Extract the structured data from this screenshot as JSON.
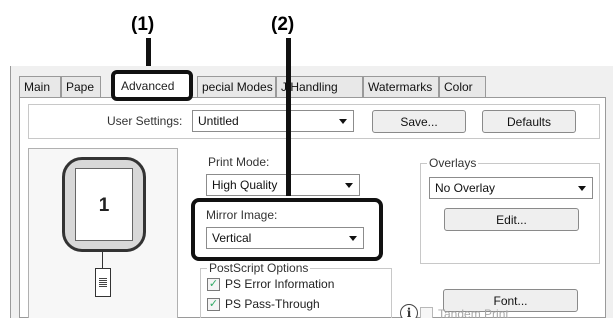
{
  "callouts": {
    "one": "(1)",
    "two": "(2)"
  },
  "tabs": {
    "main": "Main",
    "paper": "Pape",
    "advanced": "Advanced",
    "special_modes": "pecial Modes",
    "job_handling": "J  Handling",
    "watermarks": "Watermarks",
    "color": "Color"
  },
  "user_settings": {
    "label": "User Settings:",
    "value": "Untitled",
    "save_label": "Save...",
    "defaults_label": "Defaults"
  },
  "preview": {
    "page_number": "1"
  },
  "print_mode": {
    "label": "Print Mode:",
    "value": "High Quality"
  },
  "mirror_image": {
    "label": "Mirror Image:",
    "value": "Vertical"
  },
  "postscript": {
    "title": "PostScript Options",
    "error_info": {
      "label": "PS Error Information",
      "checked": true
    },
    "pass_through": {
      "label": "PS Pass-Through",
      "checked": true
    }
  },
  "overlays": {
    "title": "Overlays",
    "value": "No Overlay",
    "edit_label": "Edit..."
  },
  "font_label": "Font...",
  "tandem_print": {
    "label": "Tandem Print",
    "checked": false,
    "enabled": false
  },
  "icons": {
    "info": "info-icon",
    "check": "✓"
  }
}
